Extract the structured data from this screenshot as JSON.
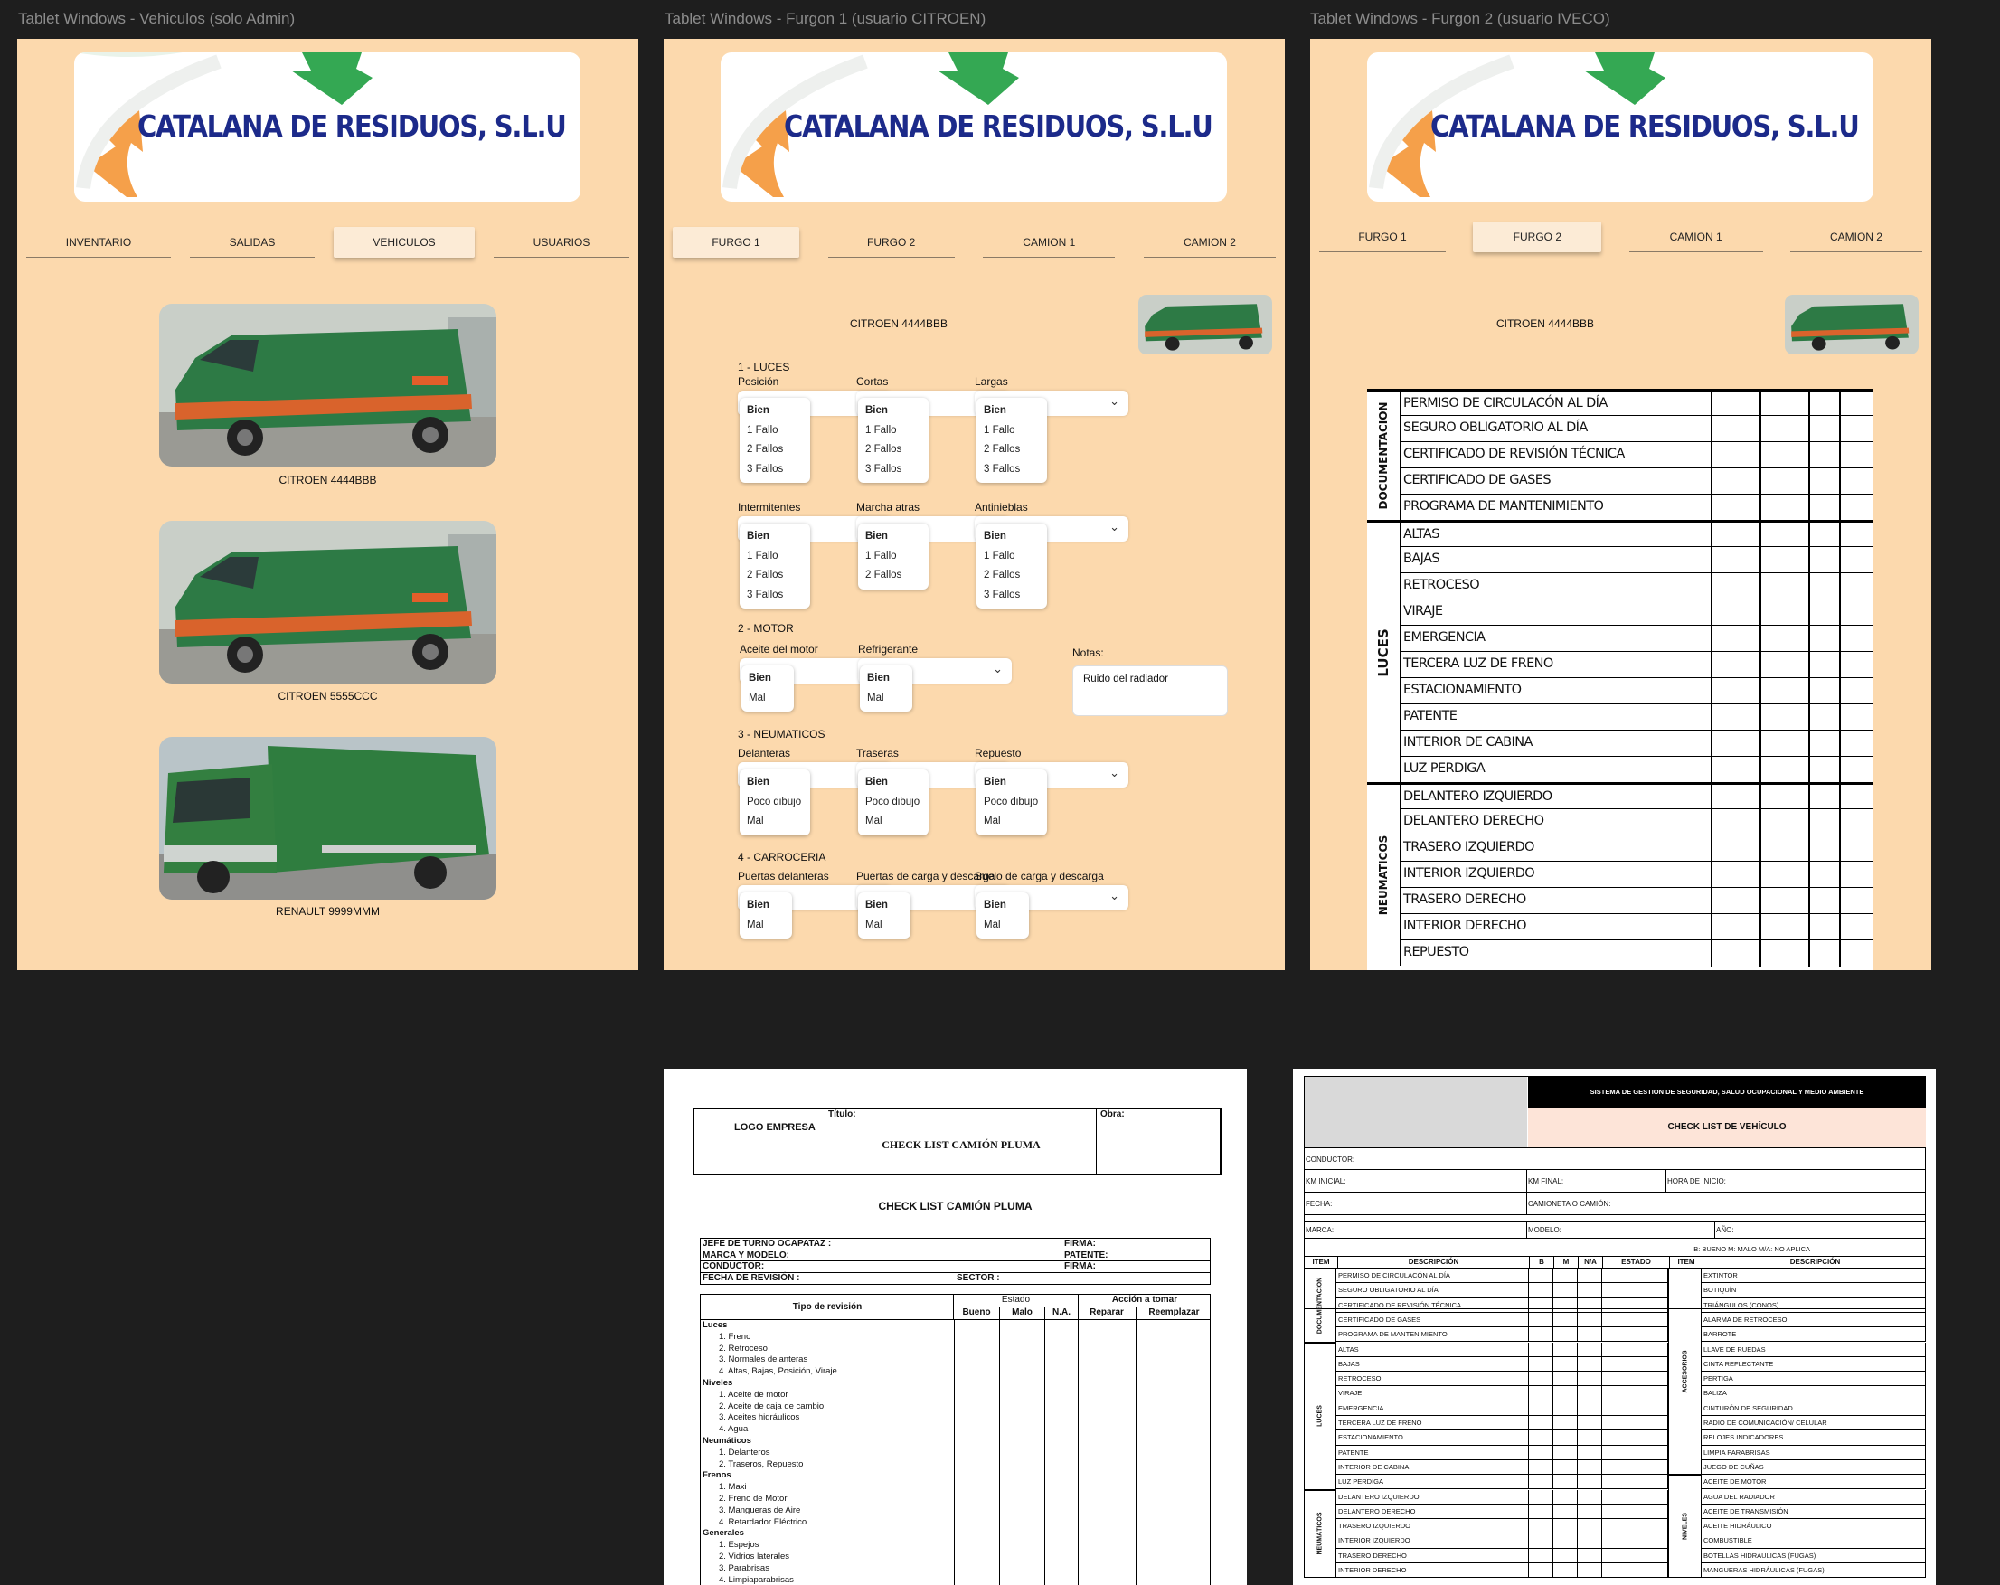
{
  "frames": {
    "admin": {
      "title": "Tablet Windows - Vehiculos (solo Admin)",
      "logo_text": "CATALANA DE RESIDUOS, S.L.U",
      "tabs": [
        "INVENTARIO",
        "SALIDAS",
        "VEHICULOS",
        "USUARIOS"
      ],
      "active_tab": "VEHICULOS",
      "vehicles": [
        "CITROEN 4444BBB",
        "CITROEN 5555CCC",
        "RENAULT 9999MMM"
      ]
    },
    "furgon1": {
      "title": "Tablet Windows - Furgon 1 (usuario CITROEN)",
      "logo_text": "CATALANA DE RESIDUOS, S.L.U",
      "tabs": [
        "FURGO 1",
        "FURGO 2",
        "CAMION 1",
        "CAMION 2"
      ],
      "active_tab": "FURGO 1",
      "vehicle_name": "CITROEN 4444BBB",
      "sections": {
        "luces": "1 - LUCES",
        "motor": "2 - MOTOR",
        "neumaticos": "3 - NEUMATICOS",
        "carroceria": "4 - CARROCERIA"
      },
      "fields": {
        "posicion": {
          "label": "Posición",
          "options": [
            "Bien",
            "1 Fallo",
            "2 Fallos",
            "3 Fallos"
          ]
        },
        "cortas": {
          "label": "Cortas",
          "options": [
            "Bien",
            "1 Fallo",
            "2 Fallos",
            "3 Fallos"
          ]
        },
        "largas": {
          "label": "Largas",
          "options": [
            "Bien",
            "1 Fallo",
            "2 Fallos",
            "3 Fallos"
          ]
        },
        "intermitentes": {
          "label": "Intermitentes",
          "options": [
            "Bien",
            "1 Fallo",
            "2 Fallos",
            "3 Fallos"
          ]
        },
        "marcha_atras": {
          "label": "Marcha atras",
          "options": [
            "Bien",
            "1 Fallo",
            "2 Fallos"
          ]
        },
        "antinieblas": {
          "label": "Antinieblas",
          "options": [
            "Bien",
            "1 Fallo",
            "2 Fallos",
            "3 Fallos"
          ]
        },
        "aceite": {
          "label": "Aceite del motor",
          "options": [
            "Bien",
            "Mal"
          ]
        },
        "refrigerante": {
          "label": "Refrigerante",
          "options": [
            "Bien",
            "Mal"
          ]
        },
        "notas": {
          "label": "Notas:",
          "value": "Ruido del radiador"
        },
        "delanteras": {
          "label": "Delanteras",
          "options": [
            "Bien",
            "Poco dibujo",
            "Mal"
          ]
        },
        "traseras": {
          "label": "Traseras",
          "options": [
            "Bien",
            "Poco dibujo",
            "Mal"
          ]
        },
        "repuesto": {
          "label": "Repuesto",
          "options": [
            "Bien",
            "Poco dibujo",
            "Mal"
          ]
        },
        "puertas_del": {
          "label": "Puertas delanteras",
          "options": [
            "Bien",
            "Mal"
          ]
        },
        "puertas_carga": {
          "label": "Puertas de carga y descarga",
          "options": [
            "Bien",
            "Mal"
          ]
        },
        "suelo_carga": {
          "label": "Suelo de carga y descarga",
          "options": [
            "Bien",
            "Mal"
          ]
        }
      }
    },
    "furgon2": {
      "title": "Tablet Windows - Furgon 2 (usuario IVECO)",
      "logo_text": "CATALANA DE RESIDUOS, S.L.U",
      "tabs": [
        "FURGO 1",
        "FURGO 2",
        "CAMION 1",
        "CAMION 2"
      ],
      "active_tab": "FURGO 2",
      "vehicle_name": "CITROEN 4444BBB",
      "groups": [
        {
          "name": "DOCUMENTACION",
          "items": [
            "PERMISO DE CIRCULACÓN AL DÍA",
            "SEGURO OBLIGATORIO AL DÍA",
            "CERTIFICADO DE REVISIÓN TÉCNICA",
            "CERTIFICADO DE GASES",
            "PROGRAMA DE MANTENIMIENTO"
          ]
        },
        {
          "name": "LUCES",
          "items": [
            "ALTAS",
            "BAJAS",
            "RETROCESO",
            "VIRAJE",
            "EMERGENCIA",
            "TERCERA LUZ DE FRENO",
            "ESTACIONAMIENTO",
            "PATENTE",
            "INTERIOR DE CABINA",
            "LUZ PERDIGA"
          ]
        },
        {
          "name": "NEUMATICOS",
          "items": [
            "DELANTERO IZQUIERDO",
            "DELANTERO DERECHO",
            "TRASERO IZQUIERDO",
            "INTERIOR IZQUIERDO",
            "TRASERO DERECHO",
            "INTERIOR DERECHO",
            "REPUESTO"
          ]
        }
      ]
    }
  },
  "doc_pluma": {
    "logo": "LOGO EMPRESA",
    "titulo_label": "Título:",
    "titulo": "CHECK LIST CAMIÓN PLUMA",
    "obra_label": "Obra:",
    "heading": "CHECK LIST CAMIÓN PLUMA",
    "jefe": "JEFE DE TURNO OCAPATAZ      :",
    "firma1": "FIRMA:",
    "marca": "MARCA Y MODELO:",
    "patente": "PATENTE:",
    "conductor": "CONDUCTOR:",
    "firma2": "FIRMA:",
    "fecha": "FECHA DE REVISIÓN :",
    "sector": "SECTOR :",
    "tipo": "Tipo de revisión",
    "estado": "Estado",
    "accion": "Acción a tomar",
    "cols": [
      "Bueno",
      "Malo",
      "N.A.",
      "Reparar",
      "Reemplazar"
    ],
    "rows": [
      {
        "h": "Luces"
      },
      {
        "t": "1.    Freno"
      },
      {
        "t": "2.    Retroceso"
      },
      {
        "t": "3.    Normales delanteras"
      },
      {
        "t": "4.    Altas, Bajas, Posición, Viraje"
      },
      {
        "h": "Niveles"
      },
      {
        "t": "1.    Aceite de motor"
      },
      {
        "t": "2.    Aceite de caja de cambio"
      },
      {
        "t": "3.    Aceites hidráulicos"
      },
      {
        "t": "4.    Agua"
      },
      {
        "h": "Neumáticos"
      },
      {
        "t": "1.    Delanteros"
      },
      {
        "t": "2.    Traseros, Repuesto"
      },
      {
        "h": "Frenos"
      },
      {
        "t": "1.    Maxi"
      },
      {
        "t": "2.    Freno de Motor"
      },
      {
        "t": "3.    Mangueras de Aire"
      },
      {
        "t": "4.    Retardador Eléctrico"
      },
      {
        "h": "Generales"
      },
      {
        "t": "1.    Espejos"
      },
      {
        "t": "2.    Vidrios laterales"
      },
      {
        "t": "3.    Parabrisas"
      },
      {
        "t": "4.    Limpiaparabrisas"
      }
    ]
  },
  "doc_vehiculo": {
    "header": "SISTEMA DE GESTION DE SEGURIDAD, SALUD OCUPACIONAL Y MEDIO AMBIENTE",
    "title": "CHECK LIST DE VEHÍCULO",
    "conductor": "CONDUCTOR:",
    "km_inicial": "KM INICIAL:",
    "km_final": "KM FINAL:",
    "hora_inicio": "HORA DE INICIO:",
    "fecha": "FECHA:",
    "camioneta": "CAMIONETA O CAMIÓN:",
    "marca": "MARCA:",
    "modelo": "MODELO:",
    "anio": "AÑO:",
    "legend": "B: BUENO M: MALO M/A: NO APLICA",
    "cols": [
      "ITEM",
      "DESCRIPCIÓN",
      "B",
      "M",
      "N/A",
      "ESTADO",
      "ITEM",
      "DESCRIPCIÓN"
    ],
    "left_groups": [
      {
        "name": "DOCUMENTACION",
        "items": [
          "PERMISO DE CIRCULACÓN AL DÍA",
          "SEGURO OBLIGATORIO AL DÍA",
          "CERTIFICADO DE REVISIÓN TÉCNICA",
          "CERTIFICADO DE GASES",
          "PROGRAMA DE MANTENIMIENTO"
        ]
      },
      {
        "name": "LUCES",
        "items": [
          "ALTAS",
          "BAJAS",
          "RETROCESO",
          "VIRAJE",
          "EMERGENCIA",
          "TERCERA LUZ DE FRENO",
          "ESTACIONAMIENTO",
          "PATENTE",
          "INTERIOR DE CABINA",
          "LUZ PERDIGA"
        ]
      },
      {
        "name": "NEUMÁTICOS",
        "items": [
          "DELANTERO IZQUIERDO",
          "DELANTERO DERECHO",
          "TRASERO IZQUIERDO",
          "INTERIOR IZQUIERDO",
          "TRASERO DERECHO",
          "INTERIOR DERECHO"
        ]
      }
    ],
    "right_groups": [
      {
        "name": "ACCESORIOS",
        "items": [
          "EXTINTOR",
          "BOTIQUÍN",
          "TRIÁNGULOS (CONOS)",
          "ALARMA DE RETROCESO",
          "BARROTE",
          "LLAVE DE RUEDAS",
          "CINTA REFLECTANTE",
          "PERTIGA",
          "BALIZA",
          "CINTURÓN DE SEGURIDAD",
          "RADIO DE COMUNICACIÓN/ CELULAR",
          "RELOJES INDICADORES",
          "LIMPIA PARABRISAS",
          "JUEGO DE CUÑAS"
        ]
      },
      {
        "name": "NIVELES",
        "items": [
          "ACEITE DE MOTOR",
          "AGUA DEL RADIADOR",
          "ACEITE DE TRANSMISIÓN",
          "ACEITE HIDRÁULICO",
          "COMBUSTIBLE",
          "BOTELLAS HIDRÁULICAS (FUGAS)",
          "MANGUERAS HIDRÁULICAS (FUGAS)"
        ]
      }
    ]
  }
}
